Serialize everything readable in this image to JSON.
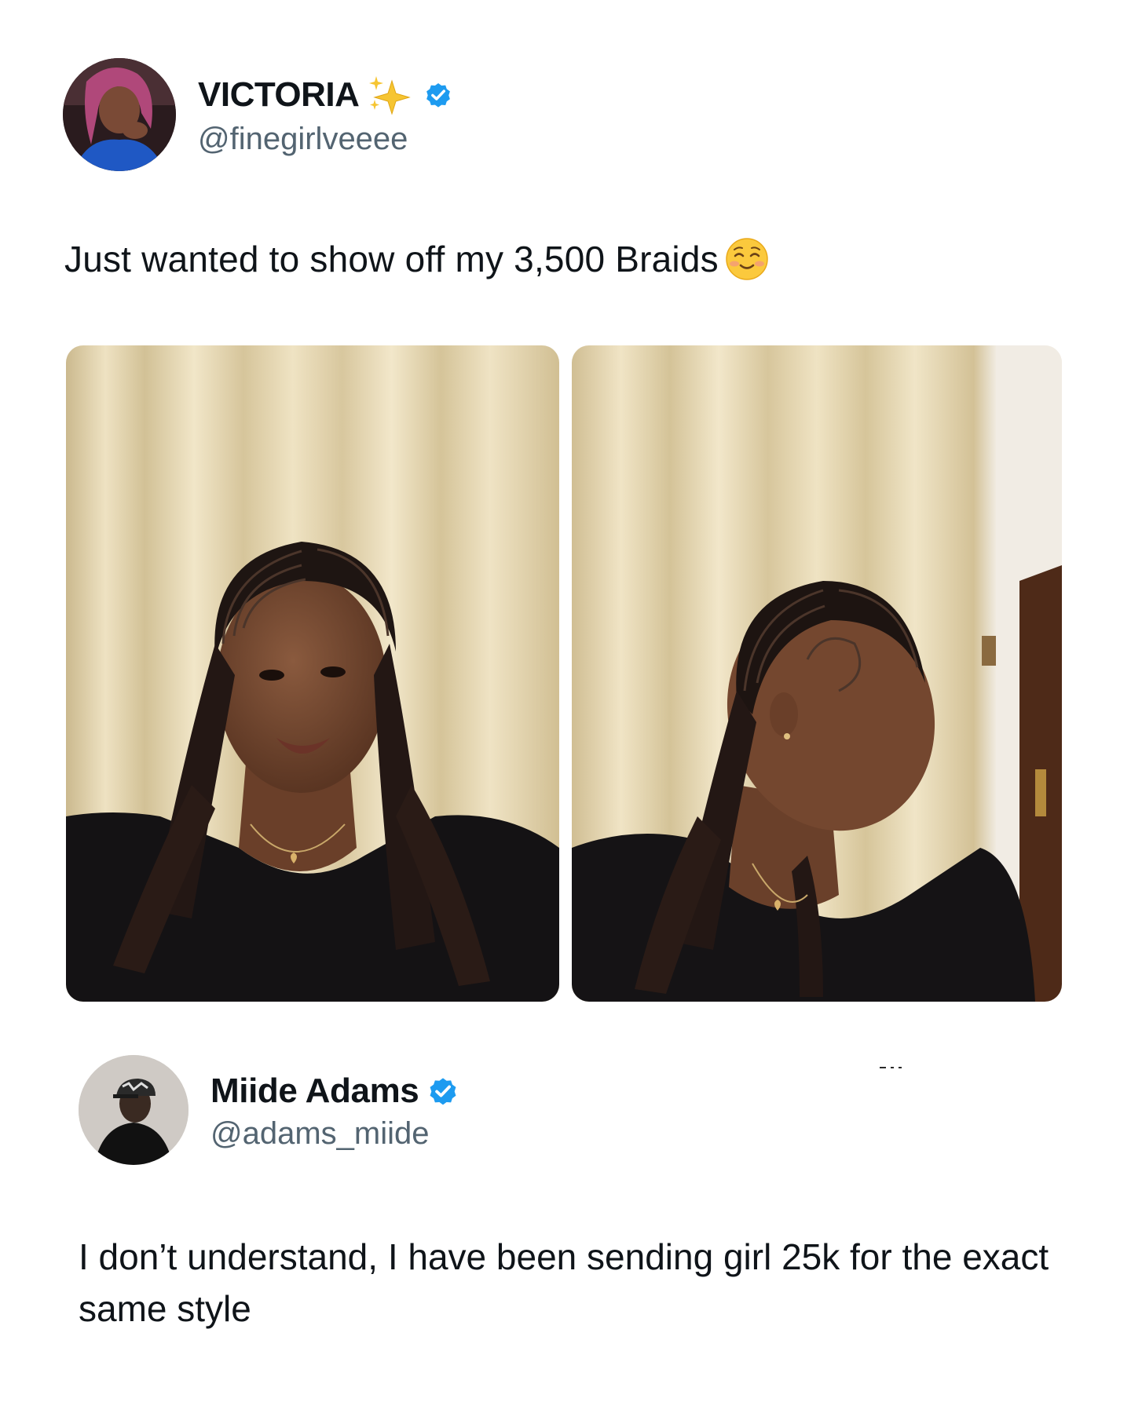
{
  "tweet": {
    "author": {
      "display_name": "VICTORIA",
      "handle": "@finegirlveeee",
      "verified": true,
      "name_emoji": "sparkles-icon"
    },
    "text": "Just wanted to show off my 3,500 Braids",
    "text_emoji": "smiling-face-icon",
    "media": [
      {
        "name": "photo-front-view"
      },
      {
        "name": "photo-side-view"
      }
    ]
  },
  "reply": {
    "author": {
      "display_name": "Miide Adams",
      "handle": "@adams_miide",
      "verified": true
    },
    "text": "I don’t understand, I have been sending girl 25k for the exact same style"
  },
  "colors": {
    "text_primary": "#0f1419",
    "text_secondary": "#536471",
    "verified_blue": "#1d9bf0",
    "curtain": "#e9dcb8"
  }
}
